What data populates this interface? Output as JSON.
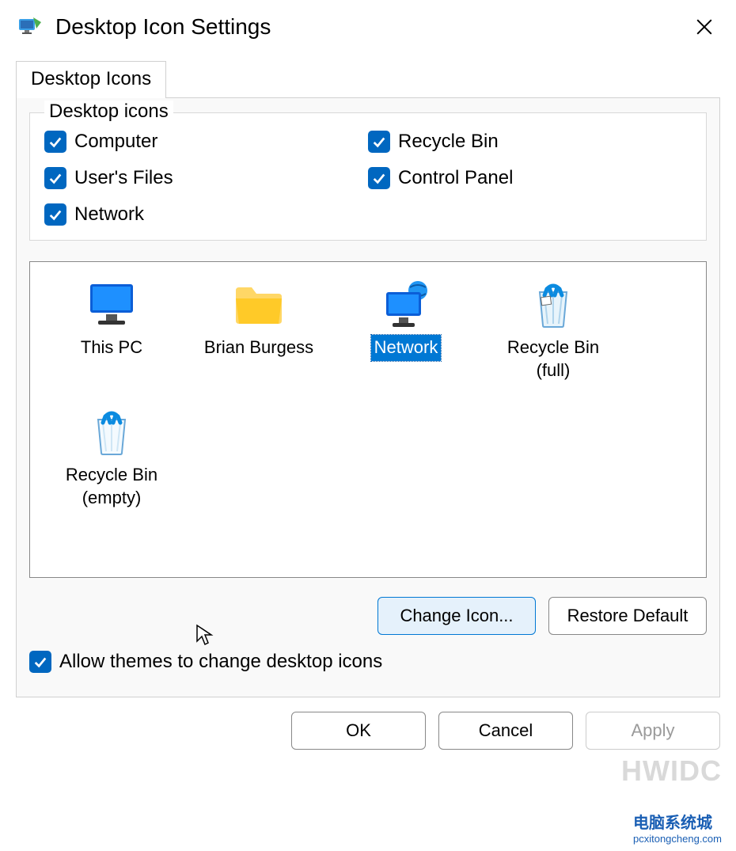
{
  "window": {
    "title": "Desktop Icon Settings"
  },
  "tab": {
    "label": "Desktop Icons"
  },
  "group": {
    "legend": "Desktop icons",
    "checkboxes": [
      {
        "label": "Computer",
        "checked": true
      },
      {
        "label": "Recycle Bin",
        "checked": true
      },
      {
        "label": "User's Files",
        "checked": true
      },
      {
        "label": "Control Panel",
        "checked": true
      },
      {
        "label": "Network",
        "checked": true
      }
    ]
  },
  "icons": [
    {
      "label": "This PC",
      "kind": "pc",
      "selected": false
    },
    {
      "label": "Brian Burgess",
      "kind": "folder",
      "selected": false
    },
    {
      "label": "Network",
      "kind": "network",
      "selected": true
    },
    {
      "label": "Recycle Bin\n(full)",
      "kind": "bin-full",
      "selected": false
    },
    {
      "label": "Recycle Bin\n(empty)",
      "kind": "bin-empty",
      "selected": false
    }
  ],
  "buttons": {
    "change_icon": "Change Icon...",
    "restore_default": "Restore Default"
  },
  "allow_themes": {
    "label": "Allow themes to change desktop icons",
    "checked": true
  },
  "footer": {
    "ok": "OK",
    "cancel": "Cancel",
    "apply": "Apply"
  },
  "watermark": {
    "big": "HWIDC",
    "brand": "电脑系统城",
    "url": "pcxitongcheng.com"
  }
}
